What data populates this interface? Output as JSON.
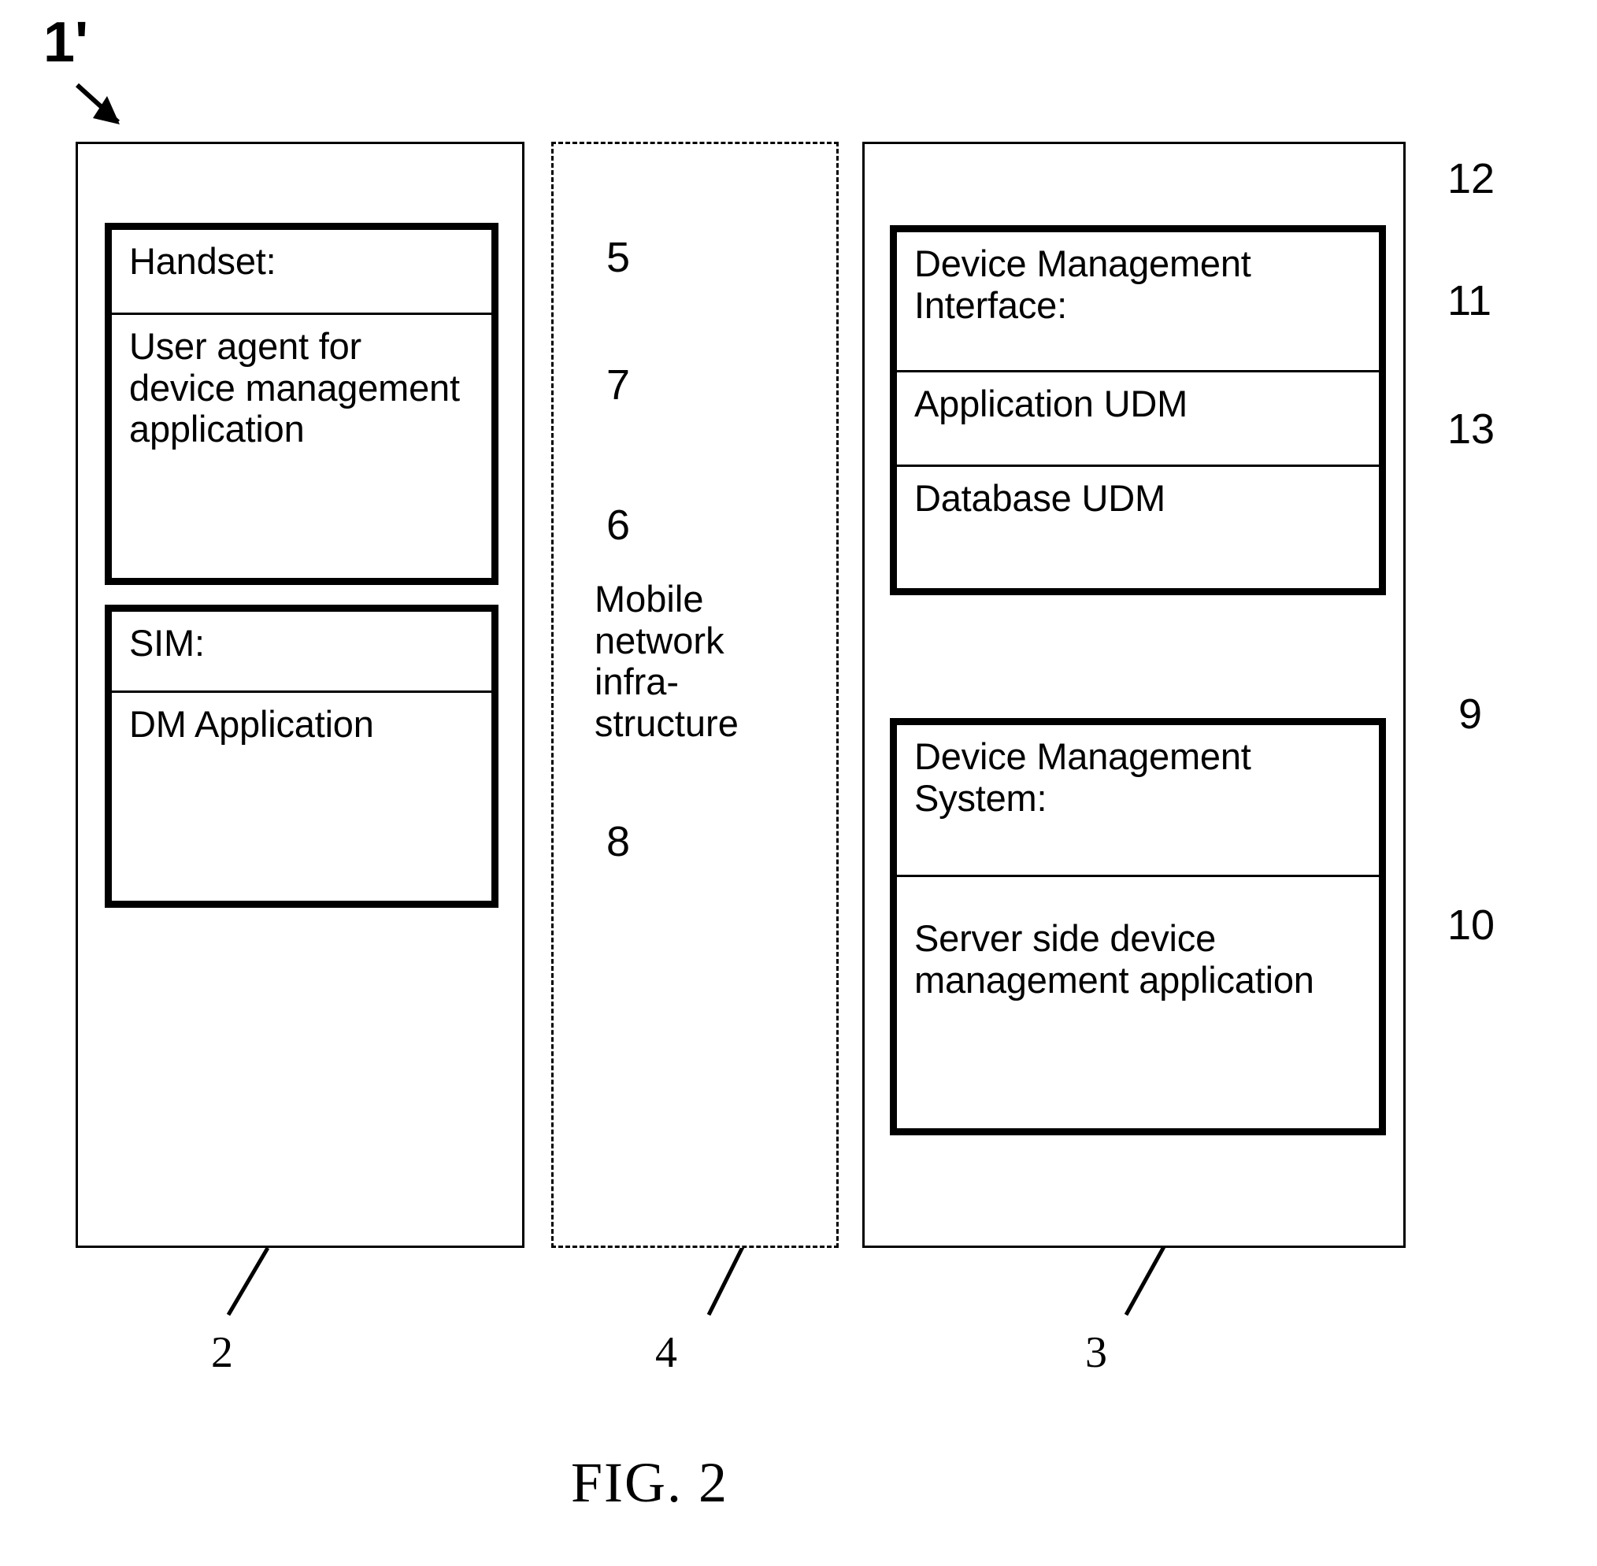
{
  "figure": {
    "caption": "FIG. 2",
    "top_label": "1'"
  },
  "columns": {
    "handset_column": {
      "ref": "2"
    },
    "network_column": {
      "ref": "4",
      "label": "Mobile\nnetwork\ninfra-\nstructure",
      "label_ref": "6"
    },
    "server_column": {
      "ref": "3"
    }
  },
  "modules": {
    "handset": {
      "ref": "5",
      "rows": [
        {
          "text": "Handset:",
          "ref": "5"
        },
        {
          "text": "User agent for device management application",
          "ref": "7"
        }
      ]
    },
    "sim": {
      "ref": "6",
      "rows": [
        {
          "text": "SIM:",
          "ref": "6"
        },
        {
          "text": "DM Application",
          "ref": "8"
        }
      ]
    },
    "dm_interface": {
      "ref": "12",
      "rows": [
        {
          "text": "Device Management Interface:",
          "ref": "12"
        },
        {
          "text": "Application UDM",
          "ref": "11"
        },
        {
          "text": "Database UDM",
          "ref": "13"
        }
      ]
    },
    "dm_system": {
      "ref": "9",
      "rows": [
        {
          "text": "Device Management System:",
          "ref": "9"
        },
        {
          "text": "Server side device management application",
          "ref": "10"
        }
      ]
    }
  },
  "reference_numerals": {
    "n1": "1'",
    "n2": "2",
    "n3": "3",
    "n4": "4",
    "n5": "5",
    "n6": "6",
    "n7": "7",
    "n8": "8",
    "n9": "9",
    "n10": "10",
    "n11": "11",
    "n12": "12",
    "n13": "13"
  },
  "colors": {
    "ink": "#000000",
    "paper": "#ffffff"
  }
}
